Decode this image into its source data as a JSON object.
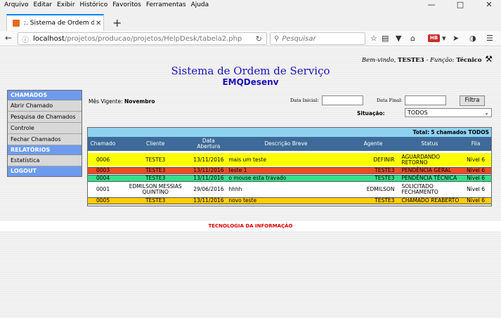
{
  "browser": {
    "menu": [
      "Arquivo",
      "Editar",
      "Exibir",
      "Histórico",
      "Favoritos",
      "Ferramentas",
      "Ajuda"
    ],
    "tab_title": ":. Sistema de Ordem de S...",
    "url_host": "localhost",
    "url_path": "/projetos/producao/projetos/HelpDesk/tabela2.php",
    "search_placeholder": "Pesquisar",
    "hb_badge": "HB"
  },
  "header": {
    "welcome_prefix": "Bem-vindo,",
    "user": "TESTE3",
    "role_prefix": "- Função:",
    "role": "Técnico",
    "title": "Sistema de Ordem de Serviço",
    "subtitle": "EMQDesenv"
  },
  "sidebar": {
    "sections": [
      {
        "heading": "CHAMADOS",
        "items": [
          "Abrir Chamado",
          "Pesquisa de Chamados",
          "Controle",
          "Fechar Chamados"
        ]
      },
      {
        "heading": "RELATÓRIOS",
        "items": [
          "Estatística"
        ]
      },
      {
        "heading": "LOGOUT",
        "items": []
      }
    ]
  },
  "filters": {
    "month_label": "Mês Vigente:",
    "month_value": "Novembro",
    "start_label": "Data Inicial:",
    "end_label": "Data Final:",
    "button": "Filtra",
    "situation_label": "Situação:",
    "situation_value": "TODOS"
  },
  "table": {
    "total_prefix": "Total:",
    "total_value": "5 chamados TODOS",
    "columns": [
      "Chamado",
      "Cliente",
      "Data Abertura",
      "Descrição Breve",
      "Agente",
      "Status",
      "Fila"
    ],
    "rows": [
      {
        "chamado": "0006",
        "cliente": "TESTE3",
        "data": "13/11/2016",
        "descricao": "mais um teste",
        "agente": "DEFINIR",
        "status": "AGUARDANDO RETORNO",
        "fila": "Nível 6",
        "bg": "#ffff00",
        "fg": "#000000"
      },
      {
        "chamado": "0003",
        "cliente": "TESTE3",
        "data": "13/11/2016",
        "descricao": "teste 1",
        "agente": "TESTE3",
        "status": "PENDÊNCIA GERAL",
        "fila": "Nível 6",
        "bg": "#f04a24",
        "fg": "#000000"
      },
      {
        "chamado": "0004",
        "cliente": "TESTE3",
        "data": "13/11/2016",
        "descricao": "o mouse esta travado",
        "agente": "TESTE3",
        "status": "PENDÊNCIA TÉCNICA",
        "fila": "Nível 6",
        "bg": "#33e08c",
        "fg": "#000000"
      },
      {
        "chamado": "0001",
        "cliente": "EDMILSON MESSIAS QUINTINO",
        "data": "29/06/2016",
        "descricao": "hhhh",
        "agente": "EDMILSON",
        "status": "SOLICITADO FECHAMENTO",
        "fila": "Nível 6",
        "bg": "#ffffff",
        "fg": "#000000"
      },
      {
        "chamado": "0005",
        "cliente": "TESTE3",
        "data": "13/11/2016",
        "descricao": "novo teste",
        "agente": "TESTE3",
        "status": "CHAMADO REABERTO",
        "fila": "Nível 6",
        "bg": "#ffcc00",
        "fg": "#000000"
      }
    ]
  },
  "footer": {
    "text": "TECNOLOGIA DA INFORMAÇÃO"
  },
  "colors": {
    "title_blue": "#1a12b8",
    "sidebar_head": "#6d9bee",
    "grid_head": "#3d6a98",
    "total_bar": "#8fd2f0",
    "footer_red": "#e00000"
  }
}
